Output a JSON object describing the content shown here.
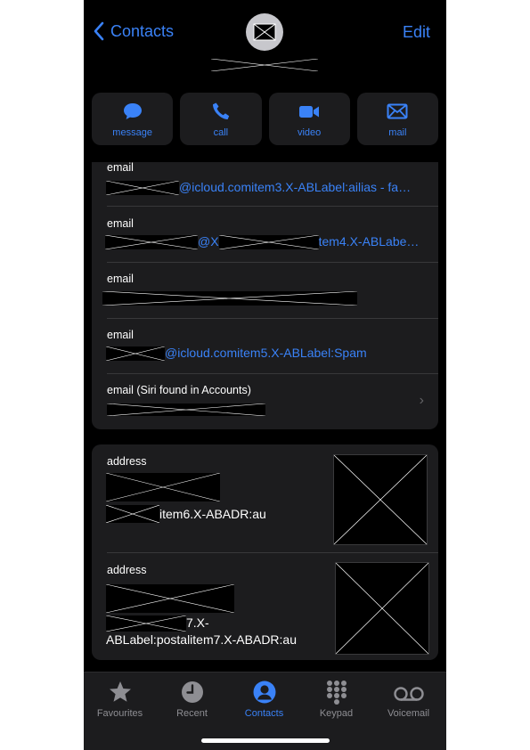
{
  "nav": {
    "back_label": "Contacts",
    "edit_label": "Edit"
  },
  "actions": [
    {
      "label": "message",
      "icon": "message-icon"
    },
    {
      "label": "call",
      "icon": "phone-icon"
    },
    {
      "label": "video",
      "icon": "video-icon"
    },
    {
      "label": "mail",
      "icon": "mail-icon"
    }
  ],
  "emails": [
    {
      "label": "email",
      "value": "@icloud.comitem3.X-ABLabel:ailias - fa…"
    },
    {
      "label": "email",
      "value_mid": "@X",
      "value_end": "tem4.X-ABLabe…"
    },
    {
      "label": "email",
      "value": ""
    },
    {
      "label": "email",
      "value": "@icloud.comitem5.X-ABLabel:Spam"
    },
    {
      "label": "email (Siri found in Accounts)",
      "value": ""
    }
  ],
  "addresses": [
    {
      "label": "address",
      "line": "item6.X-ABADR:au"
    },
    {
      "label": "address",
      "line1": "7.X-",
      "line2": "ABLabel:postalitem7.X-ABADR:au"
    }
  ],
  "tabs": [
    {
      "label": "Favourites",
      "icon": "star-icon",
      "active": false
    },
    {
      "label": "Recent",
      "icon": "clock-icon",
      "active": false
    },
    {
      "label": "Contacts",
      "icon": "person-icon",
      "active": true
    },
    {
      "label": "Keypad",
      "icon": "keypad-icon",
      "active": false
    },
    {
      "label": "Voicemail",
      "icon": "voicemail-icon",
      "active": false
    }
  ],
  "colors": {
    "accent": "#3a82f7",
    "background": "#000000",
    "card": "#1c1c1e",
    "inactive": "#8e8e93"
  }
}
